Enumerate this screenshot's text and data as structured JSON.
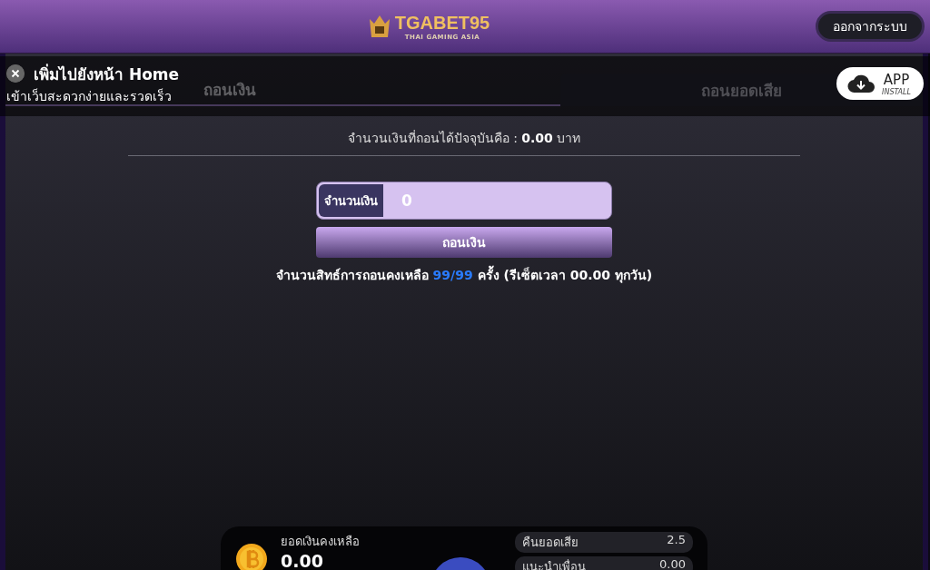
{
  "header": {
    "logo_text": "TGABET95",
    "logo_tagline": "THAI GAMING ASIA",
    "logout_button": "ออกจากระบบ"
  },
  "install_banner": {
    "title": "เพิ่มไปยังหน้า Home",
    "subtitle": "เข้าเว็บสะดวกง่ายและรวดเร็ว",
    "app_label": "APP",
    "app_sublabel": "INSTALL"
  },
  "tabs": [
    {
      "label": "ถอนเงิน",
      "selected": true
    },
    {
      "label": "ถอนยอดเสีย",
      "selected": false
    }
  ],
  "available": {
    "text": "จำนวนเงินที่ถอนได้ปัจจุบันคือ : **0.00** บาท"
  },
  "amount_field": {
    "label": "จำนวนเงิน",
    "value": "0"
  },
  "withdraw_button": "ถอนเงิน",
  "quota": {
    "text": "จำนวนสิทธ์การถอนคงเหลือ ",
    "count": "99/99",
    "rest": " ครั้ง (รีเซ็ตเวลา 00.00 ทุกวัน)"
  },
  "balance_card": {
    "label": "ยอดเงินคงเหลือ",
    "amount": "0.00",
    "stats": [
      {
        "label": "คืนยอดเสีย",
        "value": "2.5"
      },
      {
        "label": "แนะนำเพื่อน",
        "value": "0.00"
      }
    ]
  }
}
